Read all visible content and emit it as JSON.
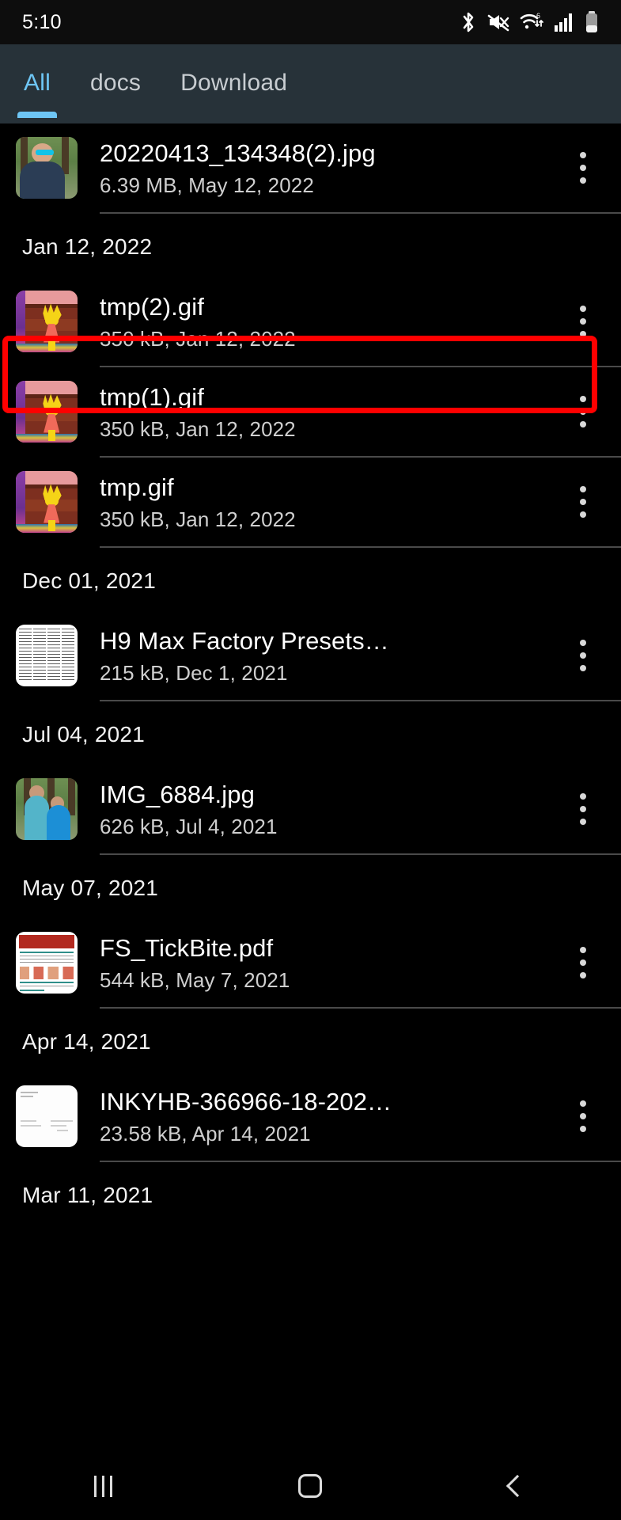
{
  "status_bar": {
    "time": "5:10",
    "icons": [
      "bluetooth-icon",
      "volume-muted-icon",
      "wifi-6-icon",
      "cellular-signal-icon",
      "battery-icon"
    ]
  },
  "tabs": [
    {
      "label": "All",
      "active": true
    },
    {
      "label": "docs",
      "active": false
    },
    {
      "label": "Download",
      "active": false
    }
  ],
  "accent_color": "#6ec6f5",
  "highlight_color": "#ff0000",
  "tabbar_background": "#273239",
  "list": [
    {
      "type": "file",
      "name": "20220413_134348(2).jpg",
      "details": "6.39 MB, May 12, 2022",
      "thumb": "photo-portrait",
      "menu": "overflow-menu-icon"
    },
    {
      "type": "date",
      "label": "Jan 12, 2022"
    },
    {
      "type": "file",
      "name": "tmp(2).gif",
      "details": "350 kB, Jan 12, 2022",
      "thumb": "gif-cartoon",
      "menu": "overflow-menu-icon",
      "highlighted": true
    },
    {
      "type": "file",
      "name": "tmp(1).gif",
      "details": "350 kB, Jan 12, 2022",
      "thumb": "gif-cartoon",
      "menu": "overflow-menu-icon"
    },
    {
      "type": "file",
      "name": "tmp.gif",
      "details": "350 kB, Jan 12, 2022",
      "thumb": "gif-cartoon",
      "menu": "overflow-menu-icon"
    },
    {
      "type": "date",
      "label": "Dec 01, 2021"
    },
    {
      "type": "file",
      "name": "H9 Max Factory Presets…",
      "details": "215 kB, Dec 1, 2021",
      "thumb": "document-text",
      "menu": "overflow-menu-icon"
    },
    {
      "type": "date",
      "label": "Jul 04, 2021"
    },
    {
      "type": "file",
      "name": "IMG_6884.jpg",
      "details": "626 kB, Jul 4, 2021",
      "thumb": "photo-two-girls",
      "menu": "overflow-menu-icon"
    },
    {
      "type": "date",
      "label": "May 07, 2021"
    },
    {
      "type": "file",
      "name": "FS_TickBite.pdf",
      "details": "544 kB, May 7, 2021",
      "thumb": "pdf-red-header",
      "menu": "overflow-menu-icon"
    },
    {
      "type": "date",
      "label": "Apr 14, 2021"
    },
    {
      "type": "file",
      "name": "INKYHB-366966-18-202…",
      "details": "23.58 kB, Apr 14, 2021",
      "thumb": "document-blank",
      "menu": "overflow-menu-icon"
    },
    {
      "type": "date",
      "label": "Mar 11, 2021"
    }
  ],
  "nav_bar": {
    "recents": "recents-icon",
    "home": "home-icon",
    "back": "back-icon"
  }
}
